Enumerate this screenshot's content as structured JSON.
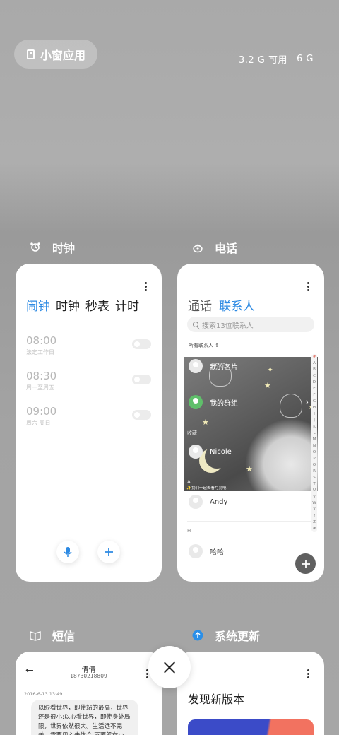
{
  "header": {
    "small_window_label": "小窗应用",
    "memory_available": "3.2 G 可用",
    "memory_total": "6 G"
  },
  "apps": {
    "clock": {
      "name": "时钟",
      "tabs": [
        "闹钟",
        "时钟",
        "秒表",
        "计时"
      ],
      "active_tab": "闹钟",
      "alarms": [
        {
          "time": "08:00",
          "repeat": "法定工作日",
          "enabled": false
        },
        {
          "time": "08:30",
          "repeat": "周一至周五",
          "enabled": false
        },
        {
          "time": "09:00",
          "repeat": "周六 周日",
          "enabled": false
        }
      ],
      "icons": [
        "microphone-icon",
        "plus-icon"
      ]
    },
    "phone": {
      "name": "电话",
      "tabs": [
        "通话",
        "联系人"
      ],
      "active_tab": "联系人",
      "search_placeholder": "搜索13位联系人",
      "filter_label": "所有联系人",
      "my_card": "我的名片",
      "my_groups": "我的群组",
      "favorites_label": "收藏",
      "contacts": {
        "nicole": "Nicole",
        "andy": "Andy",
        "haha": "哈哈"
      },
      "caption": "✨我们一起去看月亮吧",
      "section_a": "A",
      "section_h": "H",
      "index": [
        "#",
        "A",
        "B",
        "C",
        "D",
        "E",
        "F",
        "G",
        "H",
        "I",
        "J",
        "K",
        "L",
        "M",
        "N",
        "O",
        "P",
        "Q",
        "R",
        "S",
        "T",
        "U",
        "V",
        "W",
        "X",
        "Y",
        "Z",
        "#"
      ]
    },
    "messages": {
      "name": "短信",
      "contact_name": "倩倩",
      "contact_number": "18730218809",
      "date": "2016-6-13 13:49",
      "message": "以眼看世界，即使站的最高，世界还是很小;以心看世界，即使身处局限，世界依然很大。生活远不完美，需要用心去体会,不要躲在小"
    },
    "update": {
      "name": "系统更新",
      "title": "发现新版本"
    }
  },
  "colors": {
    "accent": "#2d8ae3",
    "background": "#a8a8a8"
  }
}
